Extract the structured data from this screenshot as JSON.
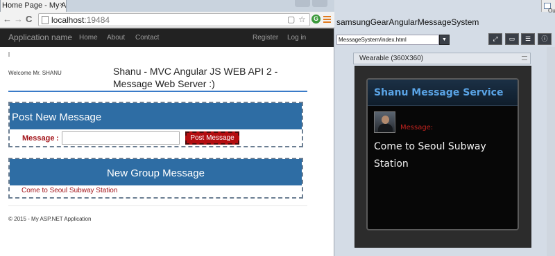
{
  "browser": {
    "tab_title": "Home Page - My A",
    "tab_close": "×",
    "url_host": "localhost",
    "url_port": ":19484",
    "nav_back": "←",
    "nav_forward": "→",
    "reload": "C",
    "star": "☆",
    "ext_badge": "G"
  },
  "site": {
    "brand": "Application name",
    "nav": [
      "Home",
      "About",
      "Contact"
    ],
    "auth": [
      "Register",
      "Log in"
    ],
    "welcome": "Welcome Mr. SHANU",
    "title": "Shanu - MVC Angular JS WEB API 2 - Message Web Server :)",
    "post_panel": {
      "heading": "Post New Message",
      "message_label": "Message",
      "colon": ":",
      "input_value": "",
      "button": "Post Message"
    },
    "group_panel": {
      "heading": "New Group Message",
      "messages": [
        "Come to Seoul Subway Station"
      ]
    },
    "footer": "© 2015 - My ASP.NET Application"
  },
  "ide": {
    "outline_label": "Outlin",
    "title": "samsungGearAngularMessageSystem",
    "combo_value": "MessageSystem/index.html",
    "combo_arrow": "▼",
    "toolbar_buttons": [
      "⤢",
      "▭",
      "☰",
      "ⓘ"
    ],
    "emulator_tab": "Wearable (360X360)"
  },
  "watch": {
    "header": "Shanu Message Service",
    "message_label": "Message:",
    "message_text": "Come to Seoul Subway Station"
  },
  "colors": {
    "navbar": "#222222",
    "panel_header": "#2e6da4",
    "accent_red": "#a21218",
    "button_red": "#b30d10",
    "watch_header_text": "#5aa4e6"
  }
}
